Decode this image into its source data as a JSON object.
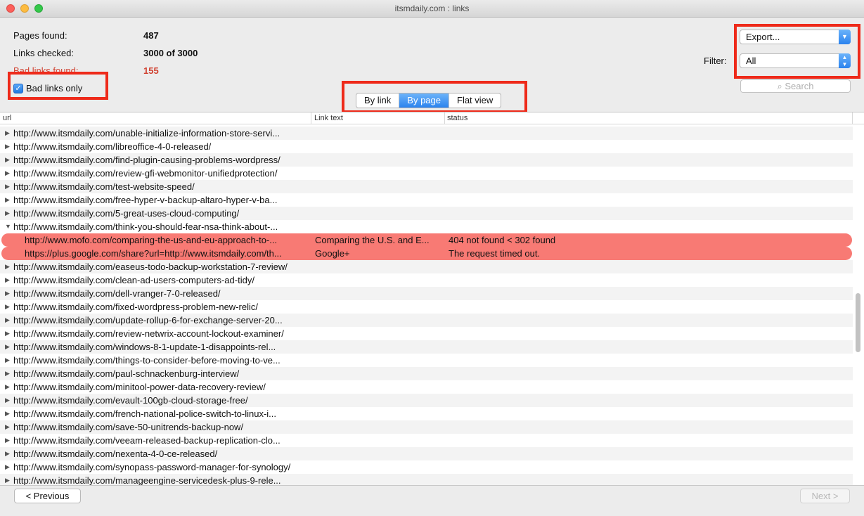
{
  "window": {
    "title": "itsmdaily.com : links"
  },
  "stats": {
    "pages_found_label": "Pages found:",
    "pages_found_value": "487",
    "links_checked_label": "Links checked:",
    "links_checked_value": "3000 of 3000",
    "bad_links_label": "Bad links found:",
    "bad_links_value": "155"
  },
  "filter_toggle": {
    "label": "Bad links only",
    "checked": true
  },
  "view_tabs": [
    "By link",
    "By page",
    "Flat view"
  ],
  "active_view": "By page",
  "export": {
    "label": "Export..."
  },
  "filter": {
    "label": "Filter:",
    "value": "All"
  },
  "search": {
    "placeholder": "Search"
  },
  "table": {
    "columns": [
      "url",
      "Link text",
      "status"
    ],
    "rows": [
      {
        "url": "http://www.itsmdaily.com/unable-initialize-information-store-servi...",
        "link_text": "",
        "status": ""
      },
      {
        "url": "http://www.itsmdaily.com/libreoffice-4-0-released/",
        "link_text": "",
        "status": ""
      },
      {
        "url": "http://www.itsmdaily.com/find-plugin-causing-problems-wordpress/",
        "link_text": "",
        "status": ""
      },
      {
        "url": "http://www.itsmdaily.com/review-gfi-webmonitor-unifiedprotection/",
        "link_text": "",
        "status": ""
      },
      {
        "url": "http://www.itsmdaily.com/test-website-speed/",
        "link_text": "",
        "status": ""
      },
      {
        "url": "http://www.itsmdaily.com/free-hyper-v-backup-altaro-hyper-v-ba...",
        "link_text": "",
        "status": ""
      },
      {
        "url": "http://www.itsmdaily.com/5-great-uses-cloud-computing/",
        "link_text": "",
        "status": ""
      },
      {
        "url": "http://www.itsmdaily.com/think-you-should-fear-nsa-think-about-...",
        "link_text": "",
        "status": "",
        "expanded": true
      },
      {
        "url": "http://www.mofo.com/comparing-the-us-and-eu-approach-to-...",
        "link_text": "Comparing the U.S. and E...",
        "status": "404 not found < 302 found",
        "bad": true
      },
      {
        "url": "https://plus.google.com/share?url=http://www.itsmdaily.com/th...",
        "link_text": "Google+",
        "status": "The request timed out.",
        "bad": true
      },
      {
        "url": "http://www.itsmdaily.com/easeus-todo-backup-workstation-7-review/",
        "link_text": "",
        "status": ""
      },
      {
        "url": "http://www.itsmdaily.com/clean-ad-users-computers-ad-tidy/",
        "link_text": "",
        "status": ""
      },
      {
        "url": "http://www.itsmdaily.com/dell-vranger-7-0-released/",
        "link_text": "",
        "status": ""
      },
      {
        "url": "http://www.itsmdaily.com/fixed-wordpress-problem-new-relic/",
        "link_text": "",
        "status": ""
      },
      {
        "url": "http://www.itsmdaily.com/update-rollup-6-for-exchange-server-20...",
        "link_text": "",
        "status": ""
      },
      {
        "url": "http://www.itsmdaily.com/review-netwrix-account-lockout-examiner/",
        "link_text": "",
        "status": ""
      },
      {
        "url": "http://www.itsmdaily.com/windows-8-1-update-1-disappoints-rel...",
        "link_text": "",
        "status": ""
      },
      {
        "url": "http://www.itsmdaily.com/things-to-consider-before-moving-to-ve...",
        "link_text": "",
        "status": ""
      },
      {
        "url": "http://www.itsmdaily.com/paul-schnackenburg-interview/",
        "link_text": "",
        "status": ""
      },
      {
        "url": "http://www.itsmdaily.com/minitool-power-data-recovery-review/",
        "link_text": "",
        "status": ""
      },
      {
        "url": "http://www.itsmdaily.com/evault-100gb-cloud-storage-free/",
        "link_text": "",
        "status": ""
      },
      {
        "url": "http://www.itsmdaily.com/french-national-police-switch-to-linux-i...",
        "link_text": "",
        "status": ""
      },
      {
        "url": "http://www.itsmdaily.com/save-50-unitrends-backup-now/",
        "link_text": "",
        "status": ""
      },
      {
        "url": "http://www.itsmdaily.com/veeam-released-backup-replication-clo...",
        "link_text": "",
        "status": ""
      },
      {
        "url": "http://www.itsmdaily.com/nexenta-4-0-ce-released/",
        "link_text": "",
        "status": ""
      },
      {
        "url": "http://www.itsmdaily.com/synopass-password-manager-for-synology/",
        "link_text": "",
        "status": ""
      },
      {
        "url": "http://www.itsmdaily.com/manageengine-servicedesk-plus-9-rele...",
        "link_text": "",
        "status": ""
      }
    ]
  },
  "pagination": {
    "previous_label": "< Previous",
    "next_label": "Next >"
  },
  "colors": {
    "bad_row": "#f87a74",
    "accent": "#2b83ee",
    "highlight_box": "#ee2a1a",
    "bad_text": "#d0402f"
  }
}
